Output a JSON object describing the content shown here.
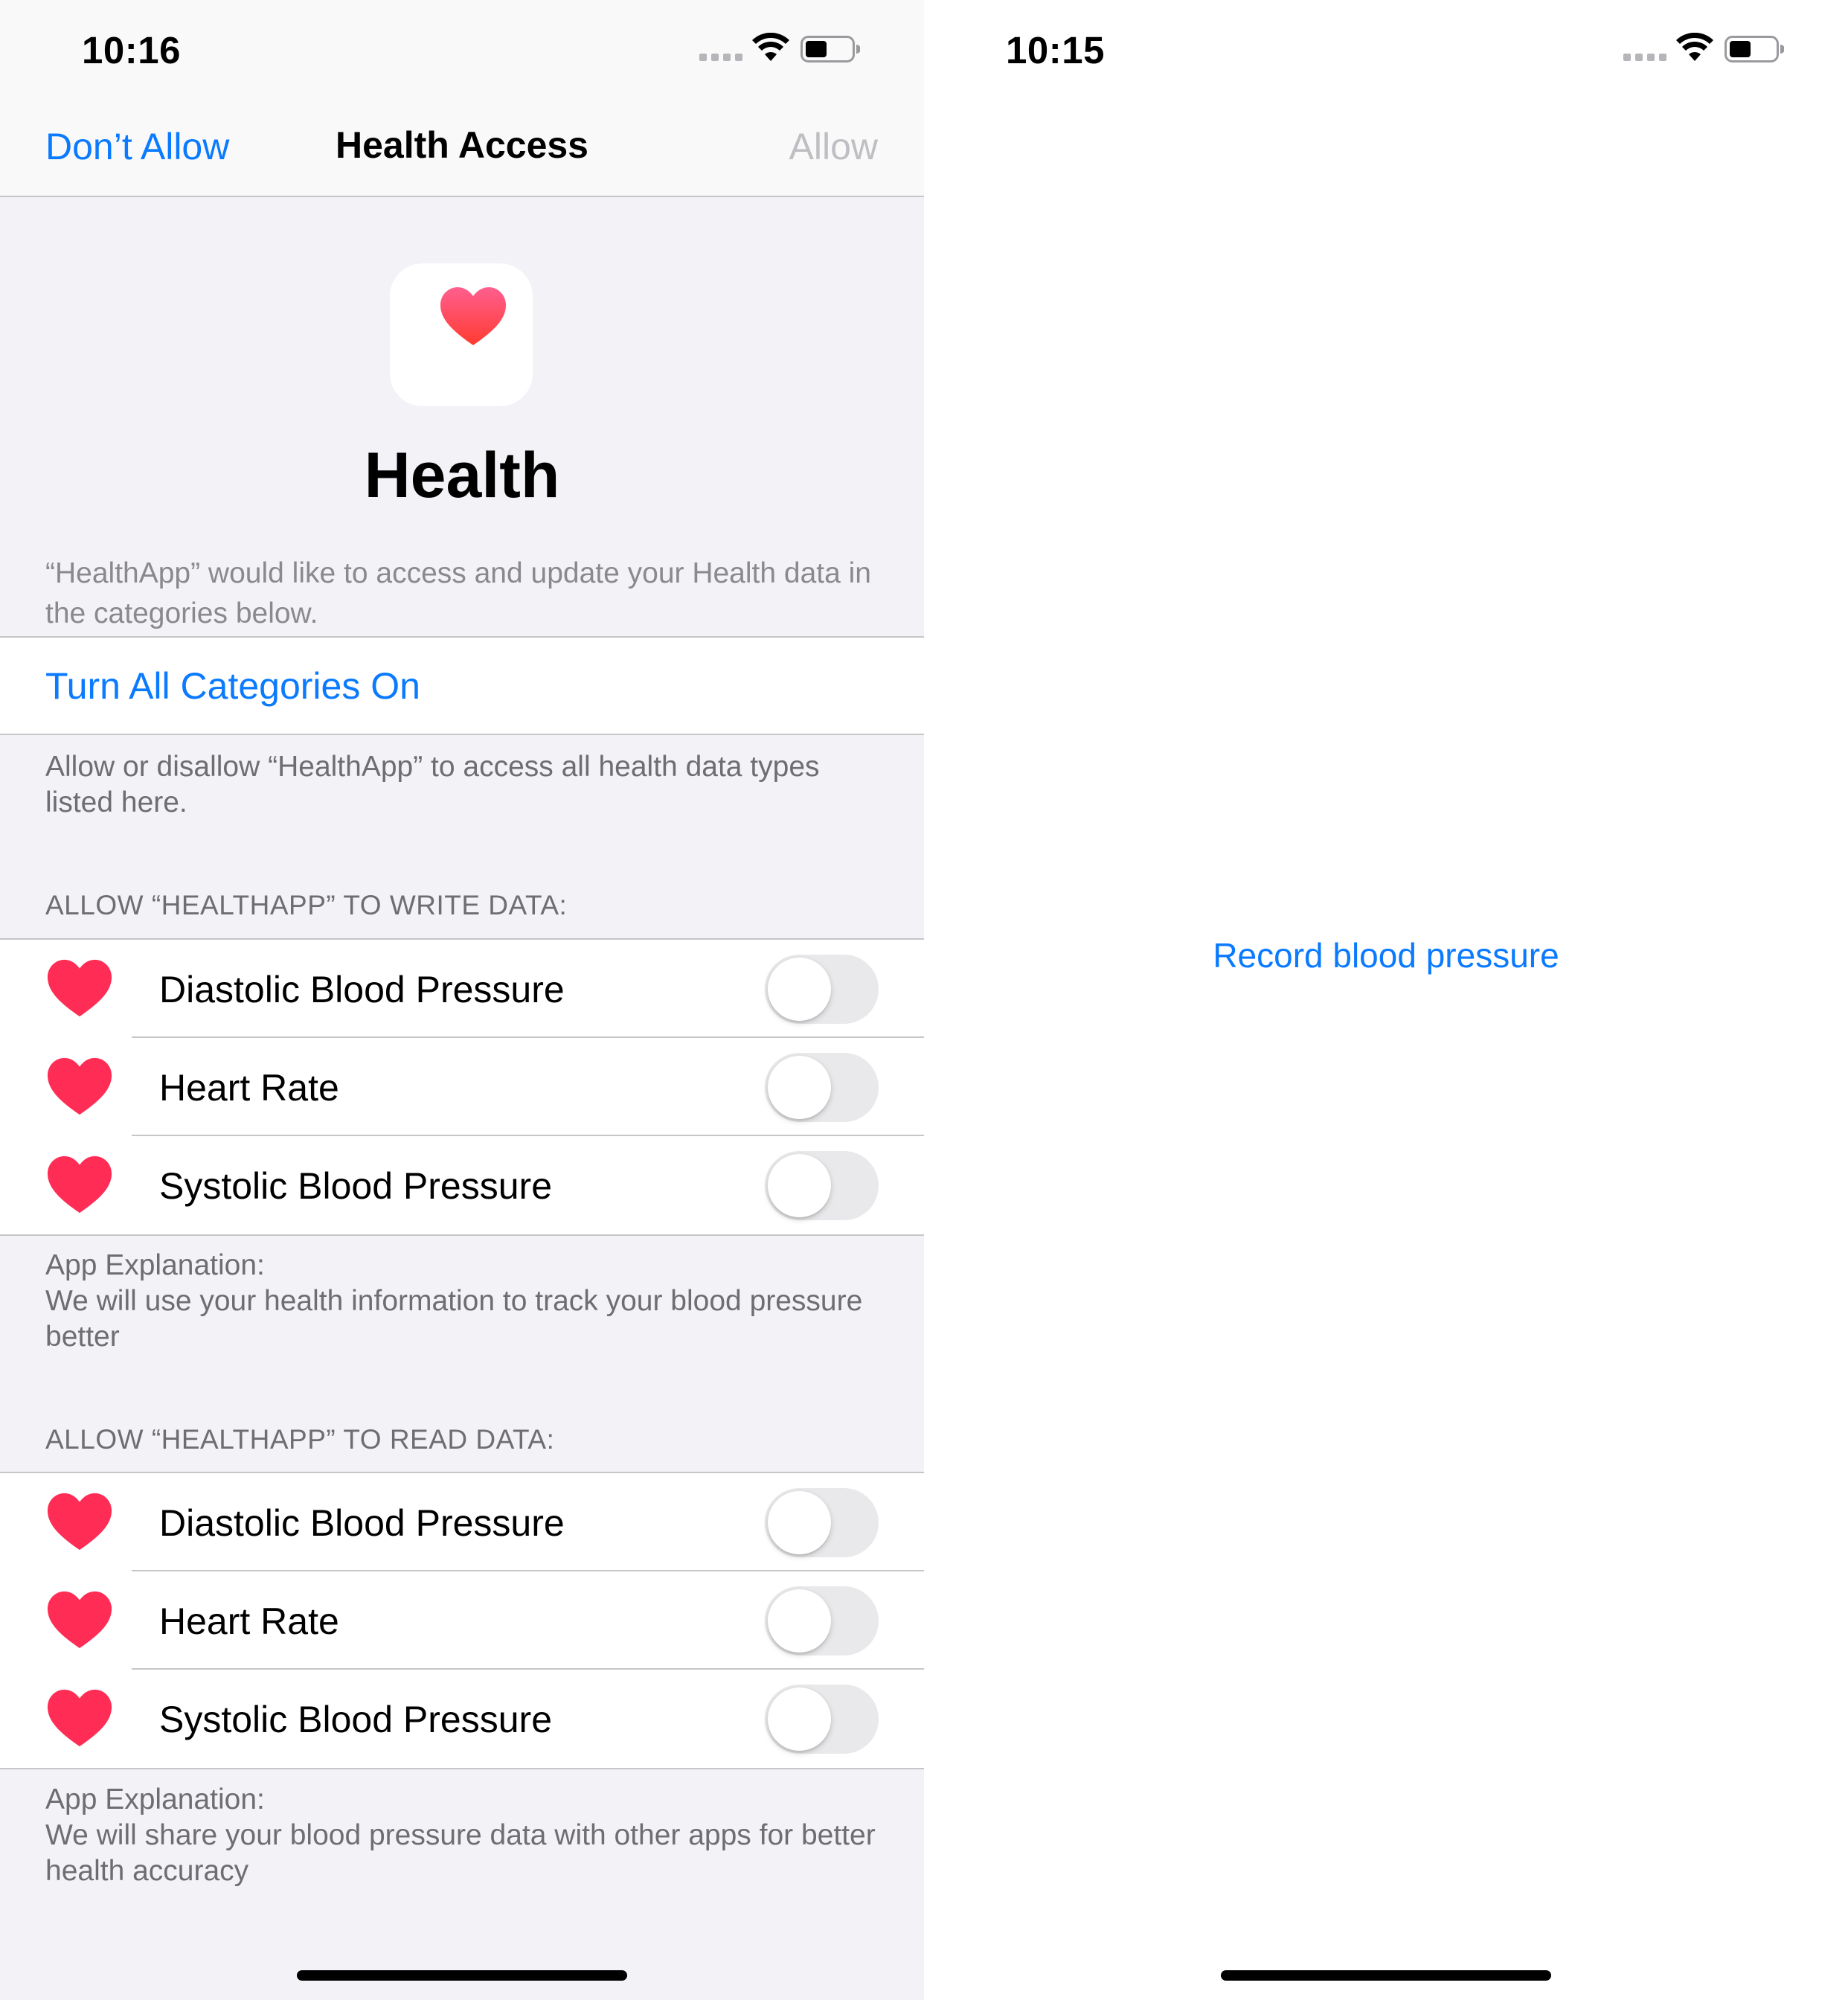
{
  "left_screen": {
    "status_time": "10:16",
    "nav": {
      "left_button": "Don’t Allow",
      "title": "Health Access",
      "right_button": "Allow"
    },
    "app_icon": "health-heart-icon",
    "app_name": "Health",
    "intro_text": "“HealthApp” would like to access and update your Health data in the categories below.",
    "turn_all_label": "Turn All Categories On",
    "turn_all_note": "Allow or disallow “HealthApp” to access all health data types listed here.",
    "write_section": {
      "header": "ALLOW “HEALTHAPP” TO WRITE DATA:",
      "items": [
        {
          "label": "Diastolic Blood Pressure",
          "on": false
        },
        {
          "label": "Heart Rate",
          "on": false
        },
        {
          "label": "Systolic Blood Pressure",
          "on": false
        }
      ],
      "explanation_title": "App Explanation:",
      "explanation_text": "We will use your health information to track your blood pressure better"
    },
    "read_section": {
      "header": "ALLOW “HEALTHAPP” TO READ DATA:",
      "items": [
        {
          "label": "Diastolic Blood Pressure",
          "on": false
        },
        {
          "label": "Heart Rate",
          "on": false
        },
        {
          "label": "Systolic Blood Pressure",
          "on": false
        }
      ],
      "explanation_title": "App Explanation:",
      "explanation_text": "We will share your blood pressure data with other apps for better health accuracy"
    }
  },
  "right_screen": {
    "status_time": "10:15",
    "record_button": "Record blood pressure"
  },
  "colors": {
    "accent": "#0a7aff",
    "heart": "#ff2d55",
    "grouped_background": "#f2f2f7",
    "secondary_text": "#6d6d72"
  }
}
